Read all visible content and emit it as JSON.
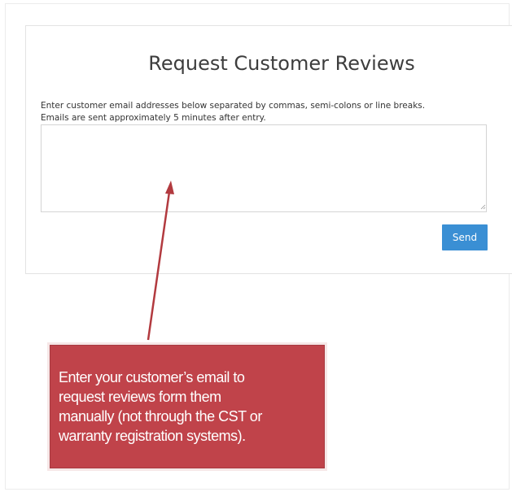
{
  "panel": {
    "title": "Request Customer Reviews",
    "instructions": [
      "Enter customer email addresses below separated by commas, semi-colons or line breaks.",
      "Emails are sent approximately 5 minutes after entry."
    ],
    "textarea_value": "",
    "send_label": "Send"
  },
  "callout": {
    "lines": [
      "Enter your customer’s email to",
      "request reviews form them",
      "manually (not through the CST or",
      "warranty registration systems)."
    ]
  },
  "colors": {
    "send_button": "#3a8fd4",
    "callout_background": "#c0434a",
    "arrow": "#b23a3f"
  },
  "icons": {
    "resize_grip": "resize-grip-icon",
    "arrow": "arrow-annotation"
  }
}
